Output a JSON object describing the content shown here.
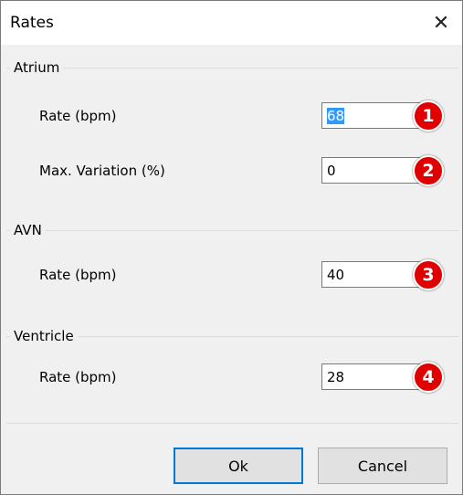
{
  "dialog": {
    "title": "Rates"
  },
  "groups": [
    {
      "title": "Atrium",
      "rows": [
        {
          "label": "Rate (bpm)",
          "value": "68",
          "badge": "1",
          "selected": true
        },
        {
          "label": "Max. Variation (%)",
          "value": "0",
          "badge": "2"
        }
      ]
    },
    {
      "title": "AVN",
      "rows": [
        {
          "label": "Rate (bpm)",
          "value": "40",
          "badge": "3"
        }
      ]
    },
    {
      "title": "Ventricle",
      "rows": [
        {
          "label": "Rate (bpm)",
          "value": "28",
          "badge": "4"
        }
      ]
    }
  ],
  "buttons": {
    "ok": "Ok",
    "cancel": "Cancel"
  },
  "colors": {
    "badge": "#e00000",
    "selection": "#3399ff",
    "default_button_border": "#0078d7"
  },
  "icons": {
    "close": "close-icon"
  }
}
